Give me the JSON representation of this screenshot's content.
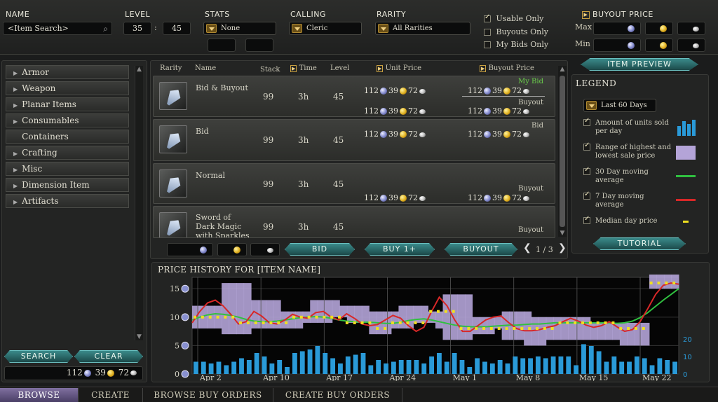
{
  "top": {
    "name_label": "NAME",
    "name_placeholder": "<Item Search>",
    "level_label": "LEVEL",
    "level_min": "35",
    "level_sep": ":",
    "level_max": "45",
    "stats_label": "STATS",
    "stats_value": "None",
    "calling_label": "CALLING",
    "calling_value": "Cleric",
    "rarity_label": "RARITY",
    "rarity_value": "All Rarities",
    "usable_only": "Usable Only",
    "buyouts_only": "Buyouts Only",
    "my_bids_only": "My Bids Only",
    "buyout_price_label": "BUYOUT PRICE",
    "max_label": "Max",
    "min_label": "Min"
  },
  "categories": [
    "Armor",
    "Weapon",
    "Planar Items",
    "Consumables",
    "Containers",
    "Crafting",
    "Misc",
    "Dimension Item",
    "Artifacts"
  ],
  "left_buttons": {
    "search": "SEARCH",
    "clear": "CLEAR"
  },
  "wallet": {
    "plat": "112",
    "gold": "39",
    "silver": "72"
  },
  "columns": {
    "rarity": "Rarity",
    "name": "Name",
    "stack": "Stack",
    "time": "Time",
    "level": "Level",
    "unit_price": "Unit Price",
    "buyout_price": "Buyout Price"
  },
  "rows": [
    {
      "name": "Bid & Buyout",
      "stack": "99",
      "time": "3h",
      "level": "45",
      "bid_plat": "112",
      "bid_gold": "39",
      "bid_silv": "72",
      "unit_plat": "112",
      "unit_gold": "39",
      "unit_silv": "72",
      "tag1": "My Bid",
      "tag2": "Buyout",
      "b_plat": "112",
      "b_gold": "39",
      "b_silv": "72",
      "bb_plat": "112",
      "bb_gold": "39",
      "bb_silv": "72"
    },
    {
      "name": "Bid",
      "stack": "99",
      "time": "3h",
      "level": "45",
      "bid_plat": "112",
      "bid_gold": "39",
      "bid_silv": "72",
      "tag1": "Bid",
      "b_plat": "112",
      "b_gold": "39",
      "b_silv": "72"
    },
    {
      "name": "Normal",
      "stack": "99",
      "time": "3h",
      "level": "45",
      "unit_plat": "112",
      "unit_gold": "39",
      "unit_silv": "72",
      "tag2": "Buyout",
      "bb_plat": "112",
      "bb_gold": "39",
      "bb_silv": "72"
    },
    {
      "name": "Sword of Dark Magic with Sparkles",
      "stack": "99",
      "time": "3h",
      "level": "45",
      "tag2": "Buyout"
    }
  ],
  "actions": {
    "bid": "BID",
    "buy": "BUY 1+",
    "buyout": "BUYOUT",
    "page": "1 / 3"
  },
  "preview": {
    "item_preview": "ITEM PREVIEW",
    "legend": "LEGEND",
    "range": "Last 60 Days",
    "tutorial": "TUTORIAL",
    "items": [
      "Amount of units sold per day",
      "Range of highest and lowest sale price",
      "30 Day moving average",
      "7 Day moving average",
      "Median day price"
    ]
  },
  "chart_data": {
    "type": "line",
    "title": "PRICE HISTORY FOR [ITEM NAME]",
    "x": [
      "Apr 2",
      "Apr 10",
      "Apr 17",
      "Apr 24",
      "May 1",
      "May 8",
      "May 15",
      "May 22"
    ],
    "ylim": [
      0,
      17
    ],
    "y_ticks": [
      "15",
      "10",
      "5",
      "0"
    ],
    "y2_ticks": [
      "20",
      "10",
      "0"
    ],
    "series": [
      {
        "name": "Amount of units sold per day",
        "color": "#2a9ad8",
        "values": [
          7,
          7,
          6,
          7,
          5,
          7,
          9,
          8,
          12,
          10,
          6,
          8,
          4,
          12,
          13,
          14,
          16,
          12,
          9,
          6,
          10,
          11,
          12,
          5,
          8,
          6,
          7,
          8,
          8,
          8,
          6,
          10,
          12,
          7,
          12,
          8,
          4,
          9,
          7,
          6,
          8,
          6,
          10,
          9,
          9,
          10,
          9,
          10,
          10,
          10,
          5,
          17,
          16,
          13,
          7,
          10,
          7,
          7,
          10,
          9,
          5,
          9,
          8,
          7
        ]
      },
      {
        "name": "Range of highest and lowest sale price",
        "color": "#b4a4d8",
        "low": [
          8,
          8,
          8,
          8,
          7,
          7,
          7,
          7,
          8,
          8,
          8,
          8,
          8,
          8,
          8,
          9,
          9,
          9,
          9,
          10,
          10,
          9,
          9,
          9,
          7,
          7,
          7,
          8,
          8,
          8,
          9,
          9,
          9,
          8,
          6,
          6,
          6,
          6,
          7,
          7,
          7,
          8,
          6,
          6,
          6,
          5,
          5,
          5,
          6,
          6,
          6,
          6,
          6,
          6,
          6,
          6,
          6,
          6,
          5,
          5,
          5,
          5,
          15,
          15,
          15,
          15
        ],
        "high": [
          12,
          12,
          12,
          12,
          16,
          16,
          16,
          16,
          13,
          13,
          13,
          13,
          11,
          11,
          11,
          11,
          13,
          13,
          13,
          13,
          12,
          12,
          12,
          12,
          11,
          11,
          11,
          11,
          12,
          12,
          12,
          12,
          11,
          11,
          14,
          14,
          14,
          14,
          10,
          10,
          10,
          10,
          11,
          11,
          11,
          11,
          10,
          10,
          10,
          10,
          10,
          10,
          10,
          10,
          9,
          9,
          9,
          9,
          9,
          9,
          9,
          9,
          18,
          18,
          18,
          18
        ]
      },
      {
        "name": "30 Day moving average",
        "color": "#30c040",
        "values": [
          9.5,
          10,
          10.4,
          10.6,
          10.5,
          10.3,
          10,
          9.6,
          9.3,
          9.2,
          9.2,
          9.3,
          9.5,
          9.7,
          9.9,
          10,
          10.1,
          10,
          9.8,
          9.5,
          9.3,
          9.2,
          9.1,
          9.1,
          9,
          8.9,
          8.9,
          9.1,
          9.4,
          9.6,
          9.7,
          9.5,
          9.2,
          8.9,
          8.6,
          8.4,
          8.3,
          8.3,
          8.3,
          8.4,
          8.5,
          8.6,
          8.6,
          8.7,
          8.8,
          8.8,
          8.9,
          9,
          9,
          9,
          9,
          9,
          9,
          9,
          9,
          8.9,
          9,
          9.3,
          9.9,
          10.8,
          11.9,
          13,
          14,
          15
        ]
      },
      {
        "name": "7 Day moving average",
        "color": "#d82828",
        "values": [
          9,
          11,
          12.5,
          13,
          12,
          10.5,
          8.8,
          9.2,
          11,
          10.2,
          9,
          8.8,
          9.5,
          10.5,
          10,
          9.8,
          10.8,
          11,
          10,
          9.5,
          10.6,
          9.8,
          8.8,
          8.5,
          8.7,
          9.5,
          10.3,
          9.8,
          8.5,
          7.5,
          8.2,
          11,
          13.5,
          12,
          9.5,
          7.5,
          7.5,
          8.5,
          9.5,
          10,
          10.2,
          9,
          8,
          7.6,
          7.6,
          7.8,
          8.2,
          8.5,
          9.2,
          9.8,
          9.3,
          8.6,
          8.2,
          8.5,
          9.2,
          8.3,
          7.5,
          7.8,
          9.2,
          11.5,
          14,
          15.6,
          16,
          15.8
        ]
      },
      {
        "name": "Median day price",
        "color": "#f0e020",
        "values": [
          10,
          10,
          10,
          10,
          10,
          10,
          9,
          9,
          9,
          9,
          9,
          9,
          9,
          10,
          10,
          10,
          10,
          10,
          10,
          10,
          9,
          9,
          9,
          9,
          8,
          8,
          9,
          9,
          9,
          9,
          9,
          11,
          11,
          11,
          11,
          8,
          8,
          8,
          8,
          8,
          8,
          8,
          8,
          8,
          8,
          8,
          8,
          8,
          9,
          9,
          9,
          9,
          9,
          9,
          9,
          9,
          8,
          8,
          8,
          8,
          16,
          16,
          16,
          16
        ]
      }
    ]
  },
  "chart_hdr": "PRICE HISTORY FOR [ITEM NAME]",
  "bottom_tabs": [
    "BROWSE",
    "CREATE",
    "BROWSE BUY ORDERS",
    "CREATE BUY ORDERS"
  ]
}
